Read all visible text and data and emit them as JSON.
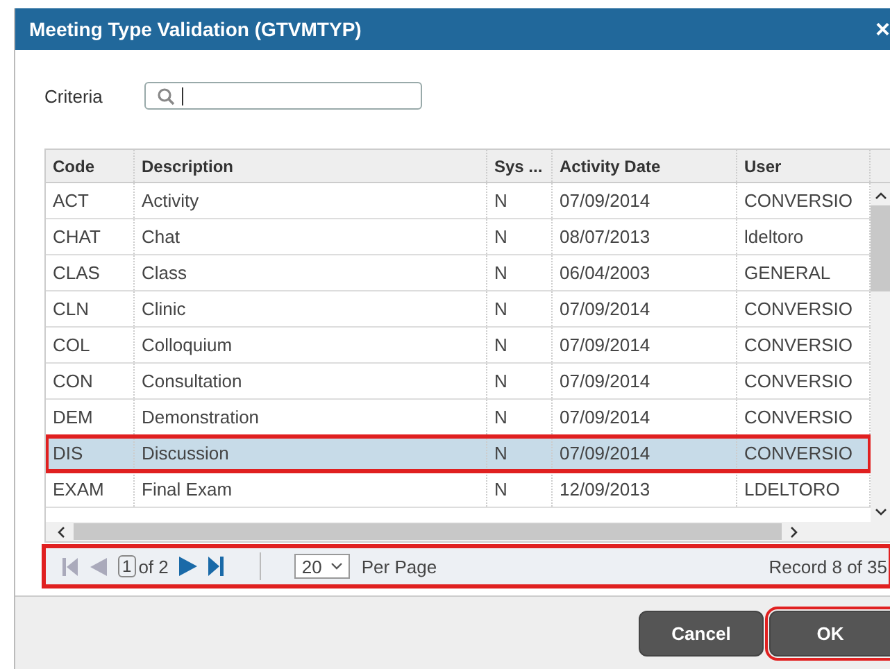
{
  "dialog": {
    "title": "Meeting Type Validation (GTVMTYP)",
    "close": "×"
  },
  "criteria": {
    "label": "Criteria"
  },
  "table": {
    "columns": [
      "Code",
      "Description",
      "Sys ...",
      "Activity Date",
      "User"
    ],
    "rows": [
      {
        "cells": [
          "ACT",
          "Activity",
          "N",
          "07/09/2014",
          "CONVERSIO"
        ],
        "selected": false,
        "annotated": false
      },
      {
        "cells": [
          "CHAT",
          "Chat",
          "N",
          "08/07/2013",
          "ldeltoro"
        ],
        "selected": false,
        "annotated": false
      },
      {
        "cells": [
          "CLAS",
          "Class",
          "N",
          "06/04/2003",
          "GENERAL"
        ],
        "selected": false,
        "annotated": false
      },
      {
        "cells": [
          "CLN",
          "Clinic",
          "N",
          "07/09/2014",
          "CONVERSIO"
        ],
        "selected": false,
        "annotated": false
      },
      {
        "cells": [
          "COL",
          "Colloquium",
          "N",
          "07/09/2014",
          "CONVERSIO"
        ],
        "selected": false,
        "annotated": false
      },
      {
        "cells": [
          "CON",
          "Consultation",
          "N",
          "07/09/2014",
          "CONVERSIO"
        ],
        "selected": false,
        "annotated": false
      },
      {
        "cells": [
          "DEM",
          "Demonstration",
          "N",
          "07/09/2014",
          "CONVERSIO"
        ],
        "selected": false,
        "annotated": false
      },
      {
        "cells": [
          "DIS",
          "Discussion",
          "N",
          "07/09/2014",
          "CONVERSIO"
        ],
        "selected": true,
        "annotated": true
      },
      {
        "cells": [
          "EXAM",
          "Final Exam",
          "N",
          "12/09/2013",
          "LDELTORO"
        ],
        "selected": false,
        "annotated": false
      }
    ]
  },
  "pager": {
    "page": "1",
    "of": "of 2",
    "per_page": "20",
    "per_page_label": "Per Page",
    "record": "Record 8 of 35",
    "annotated": true
  },
  "buttons": [
    {
      "label": "Cancel",
      "annotated": false
    },
    {
      "label": "OK",
      "annotated": true
    }
  ]
}
